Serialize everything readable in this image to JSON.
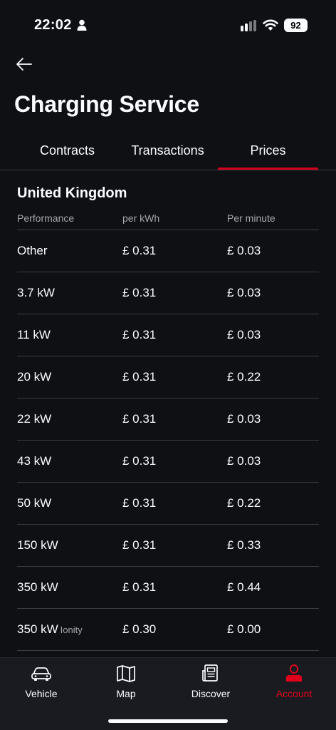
{
  "status_bar": {
    "time": "22:02",
    "battery": "92"
  },
  "header": {
    "title": "Charging Service"
  },
  "tabs": [
    {
      "label": "Contracts",
      "active": false
    },
    {
      "label": "Transactions",
      "active": false
    },
    {
      "label": "Prices",
      "active": true
    }
  ],
  "prices": {
    "region": "United Kingdom",
    "columns": {
      "performance": "Performance",
      "per_kwh": "per kWh",
      "per_minute": "Per minute"
    },
    "rows": [
      {
        "performance": "Other",
        "note": "",
        "per_kwh": "£ 0.31",
        "per_minute": "£ 0.03"
      },
      {
        "performance": "3.7 kW",
        "note": "",
        "per_kwh": "£ 0.31",
        "per_minute": "£ 0.03"
      },
      {
        "performance": "11 kW",
        "note": "",
        "per_kwh": "£ 0.31",
        "per_minute": "£ 0.03"
      },
      {
        "performance": "20 kW",
        "note": "",
        "per_kwh": "£ 0.31",
        "per_minute": "£ 0.22"
      },
      {
        "performance": "22 kW",
        "note": "",
        "per_kwh": "£ 0.31",
        "per_minute": "£ 0.03"
      },
      {
        "performance": "43 kW",
        "note": "",
        "per_kwh": "£ 0.31",
        "per_minute": "£ 0.03"
      },
      {
        "performance": "50 kW",
        "note": "",
        "per_kwh": "£ 0.31",
        "per_minute": "£ 0.22"
      },
      {
        "performance": "150 kW",
        "note": "",
        "per_kwh": "£ 0.31",
        "per_minute": "£ 0.33"
      },
      {
        "performance": "350 kW",
        "note": "",
        "per_kwh": "£ 0.31",
        "per_minute": "£ 0.44"
      },
      {
        "performance": "350 kW",
        "note": "Ionity",
        "per_kwh": "£ 0.30",
        "per_minute": "£ 0.00"
      }
    ]
  },
  "bottom_nav": [
    {
      "label": "Vehicle",
      "icon": "car-icon",
      "active": false
    },
    {
      "label": "Map",
      "icon": "map-icon",
      "active": false
    },
    {
      "label": "Discover",
      "icon": "newspaper-icon",
      "active": false
    },
    {
      "label": "Account",
      "icon": "person-icon",
      "active": true
    }
  ],
  "colors": {
    "background": "#0e1014",
    "accent": "#d5001c",
    "nav_background": "#1a1b20",
    "muted_text": "#a6a7ab",
    "divider": "#3b3d42"
  }
}
